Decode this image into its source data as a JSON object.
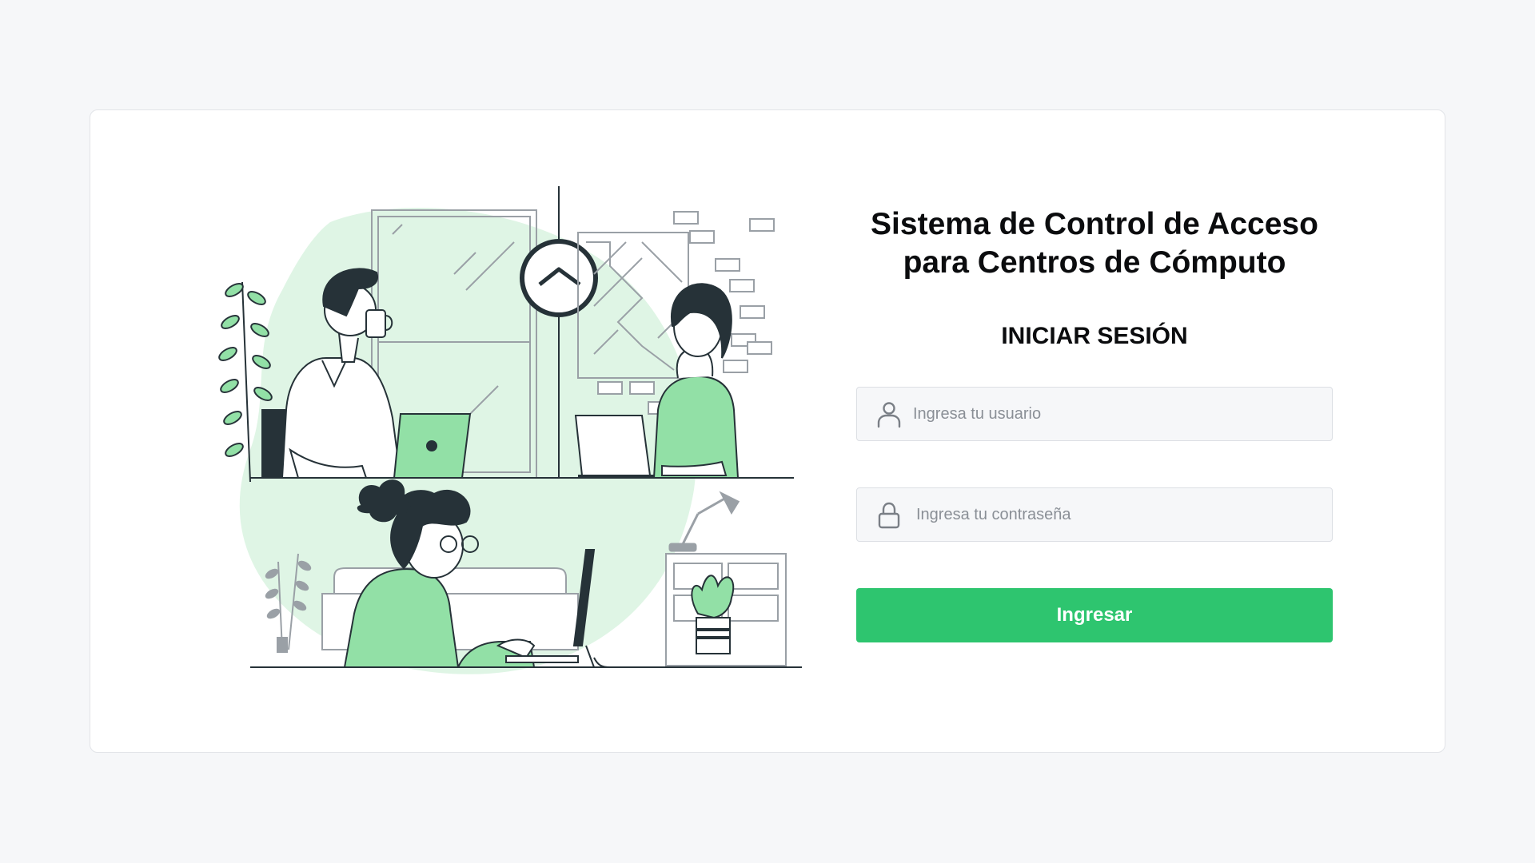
{
  "login": {
    "title_line1": "Sistema de Control de Acceso",
    "title_line2": "para Centros de Cómputo",
    "subtitle": "INICIAR SESIÓN",
    "username": {
      "value": "",
      "placeholder": "Ingresa tu usuario",
      "icon": "user-icon"
    },
    "password": {
      "value": "",
      "placeholder": "Ingresa tu contraseña",
      "icon": "lock-icon"
    },
    "submit_label": "Ingresar"
  },
  "theme": {
    "accent": "#2ec56f",
    "illustration_green": "#92e0a6",
    "illustration_blob": "#dff5e5",
    "ink": "#263238"
  },
  "illustration": {
    "icon": "office-workers-illustration"
  }
}
